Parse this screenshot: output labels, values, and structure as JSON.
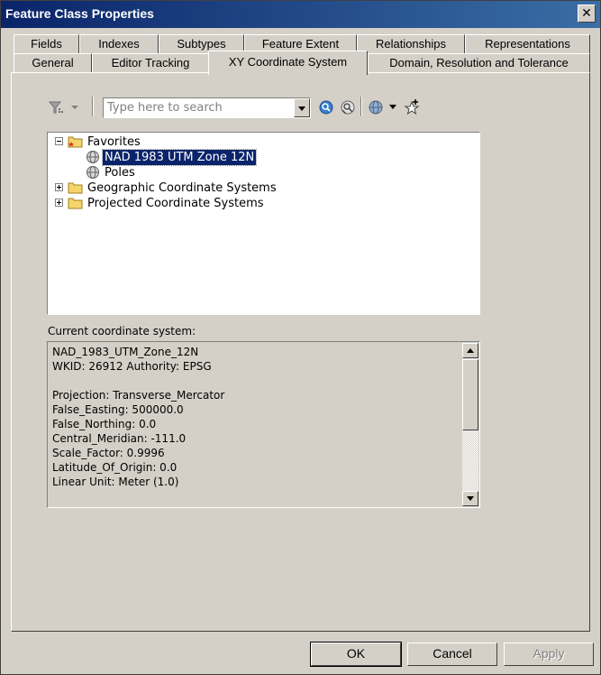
{
  "window": {
    "title": "Feature Class Properties",
    "close_glyph": "✕"
  },
  "tabs_row1": [
    "Fields",
    "Indexes",
    "Subtypes",
    "Feature Extent",
    "Relationships",
    "Representations"
  ],
  "tabs_row2": [
    "General",
    "Editor Tracking",
    "XY Coordinate System",
    "Domain, Resolution and Tolerance"
  ],
  "active_tab": "XY Coordinate System",
  "toolbar": {
    "search_placeholder": "Type here to search",
    "search_value": "",
    "icons": [
      "filter-icon",
      "search-icon",
      "clear-search-icon",
      "globe-icon",
      "add-favorite-icon"
    ]
  },
  "tree": {
    "favorites": "Favorites",
    "fav_item_1": "NAD 1983 UTM Zone 12N",
    "fav_item_2": "Poles",
    "geographic": "Geographic Coordinate Systems",
    "projected": "Projected Coordinate Systems"
  },
  "current_label": "Current coordinate system:",
  "current_info": [
    "NAD_1983_UTM_Zone_12N",
    "WKID: 26912 Authority: EPSG",
    "",
    "Projection: Transverse_Mercator",
    "False_Easting: 500000.0",
    "False_Northing: 0.0",
    "Central_Meridian: -111.0",
    "Scale_Factor: 0.9996",
    "Latitude_Of_Origin: 0.0",
    "Linear Unit: Meter (1.0)"
  ],
  "buttons": {
    "ok": "OK",
    "cancel": "Cancel",
    "apply": "Apply"
  },
  "colors": {
    "title_bar": "#0a246a",
    "selection": "#0a246a",
    "face": "#d4d0c8"
  }
}
